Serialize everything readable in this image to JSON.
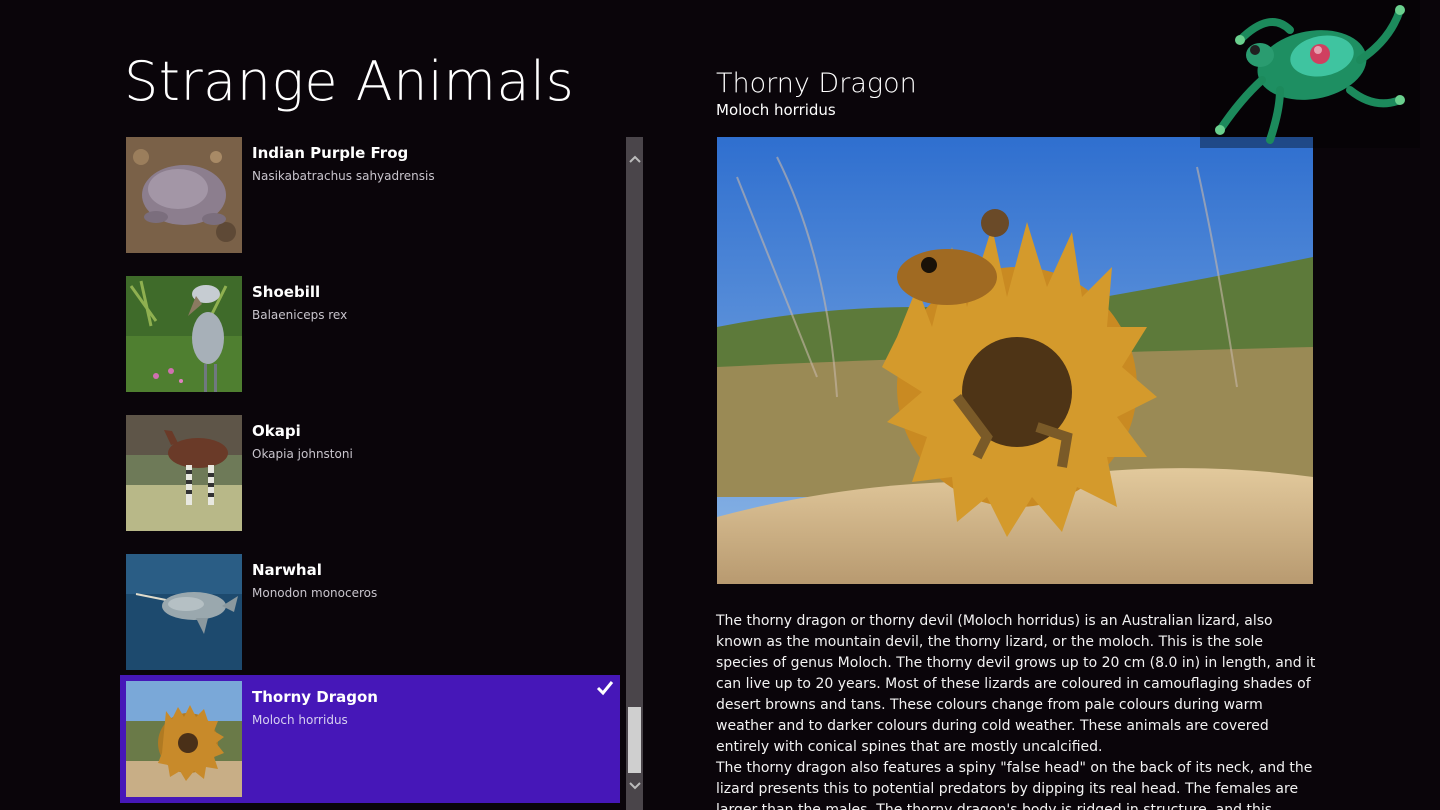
{
  "app": {
    "title": "Strange Animals"
  },
  "list": {
    "items": [
      {
        "name": "Indian Purple Frog",
        "scientific": "Nasikabatrachus sahyadrensis",
        "selected": false,
        "icon": "purple-frog-photo"
      },
      {
        "name": "Shoebill",
        "scientific": "Balaeniceps rex",
        "selected": false,
        "icon": "shoebill-photo"
      },
      {
        "name": "Okapi",
        "scientific": "Okapia johnstoni",
        "selected": false,
        "icon": "okapi-photo"
      },
      {
        "name": "Narwhal",
        "scientific": "Monodon monoceros",
        "selected": false,
        "icon": "narwhal-photo"
      },
      {
        "name": "Thorny Dragon",
        "scientific": "Moloch horridus",
        "selected": true,
        "icon": "thorny-dragon-photo"
      }
    ]
  },
  "detail": {
    "title": "Thorny Dragon",
    "subtitle": "Moloch horridus",
    "paragraph1": "The thorny dragon or thorny devil (Moloch horridus) is an Australian lizard, also known as the mountain devil, the thorny lizard, or the moloch. This is the sole species of genus Moloch. The thorny devil grows up to 20 cm (8.0 in) in length, and it can live up to 20 years. Most of these lizards are coloured in camouflaging shades of desert browns and tans. These colours change from pale colours during warm weather and to darker colours during cold weather. These animals are covered entirely with conical spines that are mostly uncalcified.",
    "paragraph2": "The thorny dragon also features a spiny \"false head\" on the back of its neck, and the lizard presents this to potential predators by dipping its real head. The females are larger than the males. The thorny dragon's body is ridged in structure, and this enables the"
  },
  "colors": {
    "background": "#0a050a",
    "selection": "#4617b8",
    "scrollbar_track": "#4a454a",
    "scrollbar_thumb": "#cfcfcf"
  }
}
